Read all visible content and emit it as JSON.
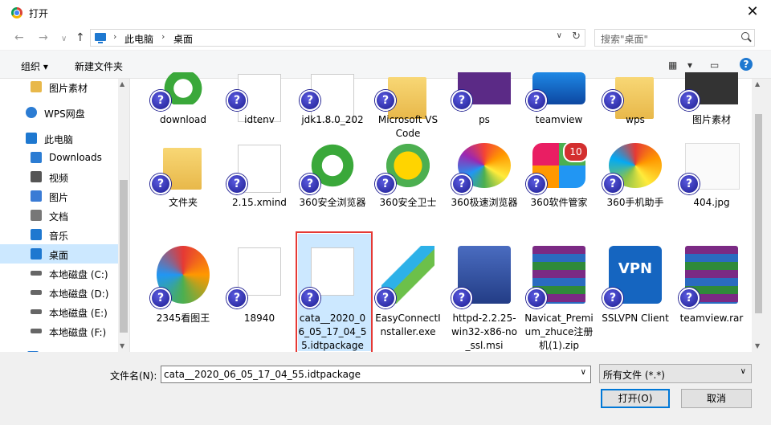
{
  "window": {
    "title": "打开",
    "close_label": "✕"
  },
  "nav": {
    "back": "←",
    "forward": "→",
    "history": "∨",
    "up": "↑"
  },
  "address": {
    "segments": [
      "此电脑",
      "桌面"
    ],
    "separator": "›",
    "dropdown": "∨",
    "refresh": "↻"
  },
  "search": {
    "placeholder": "搜索\"桌面\""
  },
  "toolbar": {
    "organize": "组织 ▾",
    "new_folder": "新建文件夹",
    "view_icon": "▦",
    "view_dd": "▾",
    "pane_icon": "▭",
    "help": "?"
  },
  "sidebar": {
    "items": [
      {
        "label": "图片素材",
        "icon": "folder-icon"
      },
      {
        "label": "WPS网盘",
        "icon": "cloud-icon"
      },
      {
        "label": "此电脑",
        "icon": "computer-icon"
      },
      {
        "label": "Downloads",
        "icon": "download-icon"
      },
      {
        "label": "视频",
        "icon": "video-icon"
      },
      {
        "label": "图片",
        "icon": "picture-icon"
      },
      {
        "label": "文档",
        "icon": "document-icon"
      },
      {
        "label": "音乐",
        "icon": "music-icon"
      },
      {
        "label": "桌面",
        "icon": "desktop-icon",
        "selected": true
      },
      {
        "label": "本地磁盘 (C:)",
        "icon": "drive-icon"
      },
      {
        "label": "本地磁盘 (D:)",
        "icon": "drive-icon"
      },
      {
        "label": "本地磁盘 (E:)",
        "icon": "drive-icon"
      },
      {
        "label": "本地磁盘 (F:)",
        "icon": "drive-icon"
      },
      {
        "label": "网络",
        "icon": "network-icon"
      }
    ]
  },
  "files": [
    {
      "name": "download",
      "kind": "ie",
      "row": 1
    },
    {
      "name": "idtenv",
      "kind": "doc",
      "row": 1
    },
    {
      "name": "jdk1.8.0_202",
      "kind": "doc",
      "row": 1
    },
    {
      "name": "Microsoft VS Code",
      "kind": "folder",
      "row": 1
    },
    {
      "name": "ps",
      "kind": "purple",
      "row": 1
    },
    {
      "name": "teamview",
      "kind": "tv",
      "row": 1
    },
    {
      "name": "wps",
      "kind": "folder",
      "row": 1
    },
    {
      "name": "图片素材",
      "kind": "dark",
      "row": 1
    },
    {
      "name": "文件夹",
      "kind": "folder",
      "row": 2
    },
    {
      "name": "2.15.xmind",
      "kind": "doc",
      "row": 2
    },
    {
      "name": "360安全浏览器",
      "kind": "e360",
      "row": 2
    },
    {
      "name": "360安全卫士",
      "kind": "guard",
      "row": 2
    },
    {
      "name": "360极速浏览器",
      "kind": "flower",
      "row": 2
    },
    {
      "name": "360软件管家",
      "kind": "mgr",
      "badge": "10",
      "row": 2
    },
    {
      "name": "360手机助手",
      "kind": "phone",
      "row": 2
    },
    {
      "name": "404.jpg",
      "kind": "sketch",
      "row": 2
    },
    {
      "name": "2345看图王",
      "kind": "pic2345",
      "row": 3
    },
    {
      "name": "18940",
      "kind": "doc",
      "row": 3
    },
    {
      "name": "cata__2020_06_05_17_04_55.idtpackage",
      "kind": "doc",
      "row": 3,
      "selected": true
    },
    {
      "name": "EasyConnectInstaller.exe",
      "kind": "ec",
      "row": 3
    },
    {
      "name": "httpd-2.2.25-win32-x86-no_ssl.msi",
      "kind": "msi",
      "row": 3
    },
    {
      "name": "Navicat_Premium_zhuce注册机(1).zip",
      "kind": "rar",
      "row": 3
    },
    {
      "name": "SSLVPN Client",
      "kind": "vpn",
      "row": 3
    },
    {
      "name": "teamview.rar",
      "kind": "rar",
      "row": 3
    }
  ],
  "unknown_badge": "?",
  "vpn_text": "VPN",
  "bottom": {
    "filename_label": "文件名(N):",
    "filename_value": "cata__2020_06_05_17_04_55.idtpackage",
    "filetype_value": "所有文件 (*.*)",
    "open_label": "打开(O)",
    "cancel_label": "取消",
    "dropdown": "∨"
  }
}
